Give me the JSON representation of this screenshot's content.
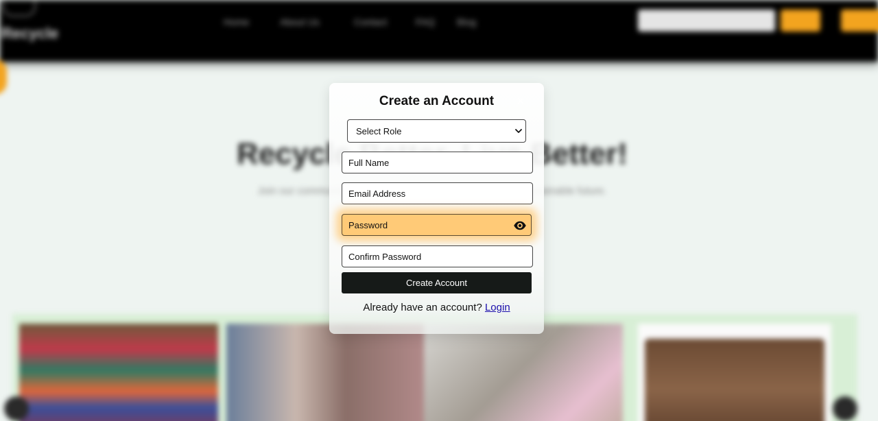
{
  "background": {
    "logo_text": "Recycle",
    "nav_links": [
      "Home",
      "About Us",
      "Contact",
      "FAQ",
      "Blog"
    ],
    "hero_title": "Recycle Better, Live Better!",
    "hero_subtitle": "Join our community and help make the world a better and sustainable future."
  },
  "modal": {
    "title": "Create an Account",
    "close_symbol": "×",
    "role_select": {
      "value": "Select Role"
    },
    "fields": {
      "full_name": "Full Name",
      "email": "Email Address",
      "password": "Password",
      "confirm_password": "Confirm Password"
    },
    "submit_label": "Create Account",
    "login_prompt": "Already have an account?",
    "login_link": "Login"
  },
  "colors": {
    "accent": "#f3a41f",
    "password_highlight": "#ffca77",
    "button": "#161a18",
    "link": "#1a0dab"
  },
  "icons": {
    "close": "close-icon",
    "select_arrow": "chevron-down-icon",
    "password_toggle": "eye-icon"
  }
}
